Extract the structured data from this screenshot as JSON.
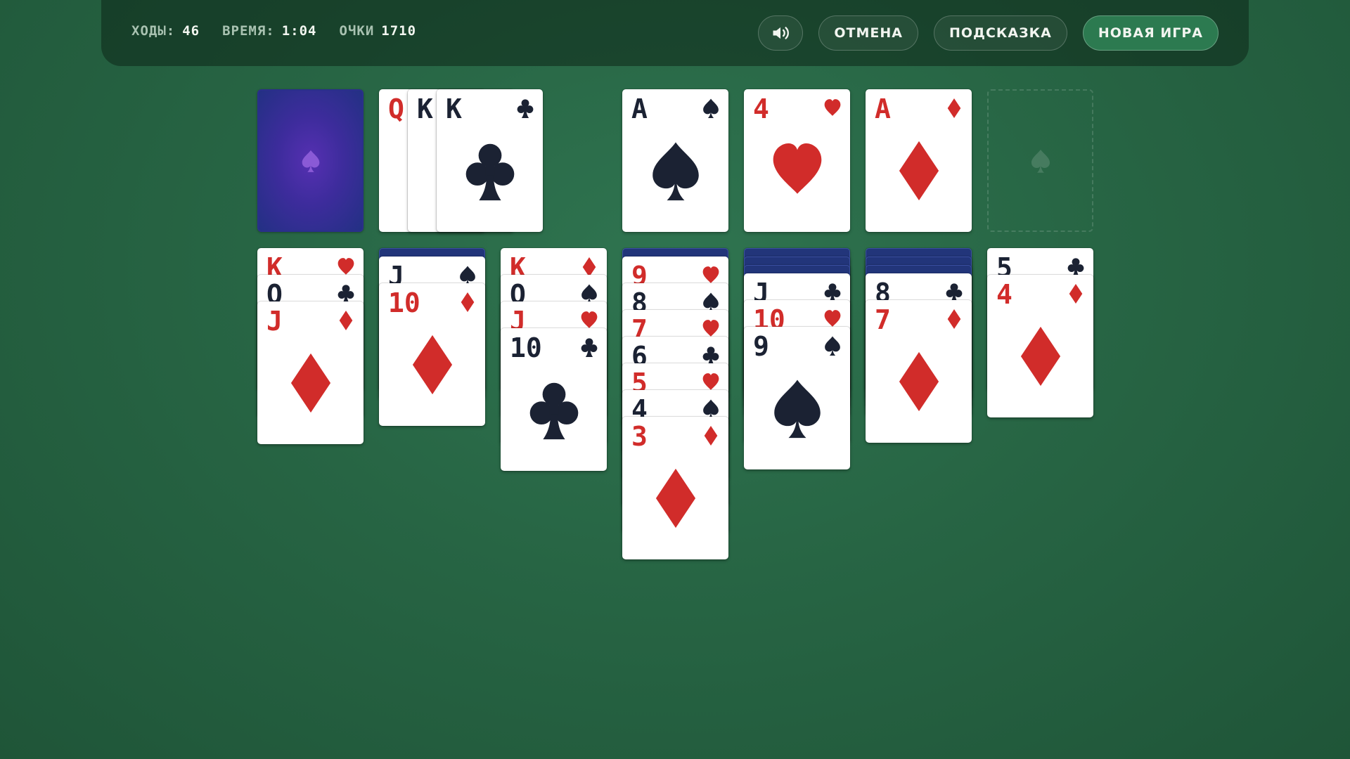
{
  "header": {
    "stats": [
      {
        "label": "ХОДЫ:",
        "value": "46"
      },
      {
        "label": "ВРЕМЯ:",
        "value": "1:04"
      },
      {
        "label": "ОЧКИ",
        "value": "1710"
      }
    ],
    "buttons": {
      "sound_icon": "speaker-icon",
      "undo_label": "ОТМЕНА",
      "hint_label": "ПОДСКАЗКА",
      "new_game_label": "НОВАЯ ИГРА"
    }
  },
  "colors": {
    "red_suit": "#d12c2a",
    "black_suit": "#1b2233",
    "felt": "#276544",
    "primary_button": "#2c7a50"
  },
  "stock": {
    "face_down": true,
    "icon": "spade-icon"
  },
  "waste": [
    {
      "rank": "Q",
      "suit": "hearts"
    },
    {
      "rank": "K",
      "suit": "clubs"
    },
    {
      "rank": "K",
      "suit": "clubs"
    }
  ],
  "foundations": [
    {
      "rank": "A",
      "suit": "spades"
    },
    {
      "rank": "4",
      "suit": "hearts"
    },
    {
      "rank": "A",
      "suit": "diamonds"
    },
    {
      "empty": true,
      "icon": "spade-icon"
    }
  ],
  "tableau": [
    {
      "face_down": 0,
      "cards": [
        {
          "rank": "K",
          "suit": "hearts"
        },
        {
          "rank": "Q",
          "suit": "clubs"
        },
        {
          "rank": "J",
          "suit": "diamonds"
        }
      ]
    },
    {
      "face_down": 1,
      "cards": [
        {
          "rank": "J",
          "suit": "spades"
        },
        {
          "rank": "10",
          "suit": "diamonds"
        }
      ]
    },
    {
      "face_down": 0,
      "cards": [
        {
          "rank": "K",
          "suit": "diamonds"
        },
        {
          "rank": "Q",
          "suit": "spades"
        },
        {
          "rank": "J",
          "suit": "hearts"
        },
        {
          "rank": "10",
          "suit": "clubs"
        }
      ]
    },
    {
      "face_down": 1,
      "cards": [
        {
          "rank": "9",
          "suit": "hearts"
        },
        {
          "rank": "8",
          "suit": "spades"
        },
        {
          "rank": "7",
          "suit": "hearts"
        },
        {
          "rank": "6",
          "suit": "clubs"
        },
        {
          "rank": "5",
          "suit": "hearts"
        },
        {
          "rank": "4",
          "suit": "spades"
        },
        {
          "rank": "3",
          "suit": "diamonds"
        }
      ]
    },
    {
      "face_down": 3,
      "cards": [
        {
          "rank": "J",
          "suit": "clubs"
        },
        {
          "rank": "10",
          "suit": "hearts"
        },
        {
          "rank": "9",
          "suit": "spades"
        }
      ]
    },
    {
      "face_down": 3,
      "cards": [
        {
          "rank": "8",
          "suit": "clubs"
        },
        {
          "rank": "7",
          "suit": "diamonds"
        }
      ]
    },
    {
      "face_down": 0,
      "cards": [
        {
          "rank": "5",
          "suit": "clubs"
        },
        {
          "rank": "4",
          "suit": "diamonds"
        }
      ]
    }
  ]
}
